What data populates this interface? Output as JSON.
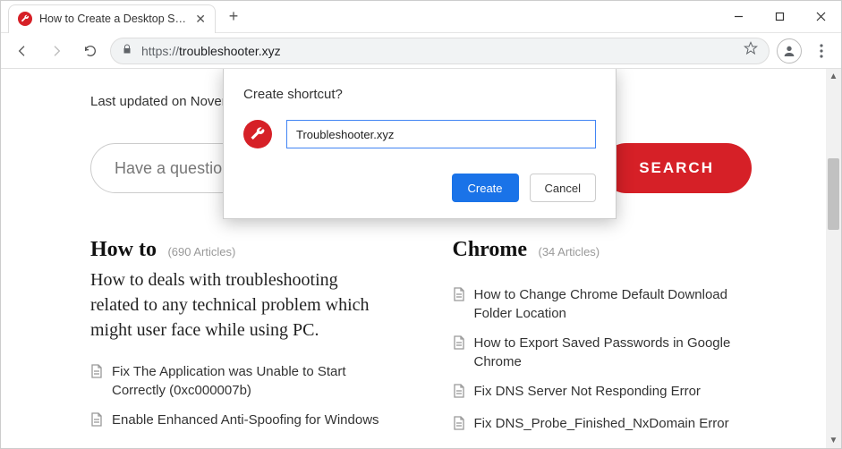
{
  "window": {
    "tab_title": "How to Create a Desktop Shortcu"
  },
  "toolbar": {
    "url_scheme": "https://",
    "url_rest": "troubleshooter.xyz"
  },
  "dialog": {
    "title": "Create shortcut?",
    "input_value": "Troubleshooter.xyz",
    "create_label": "Create",
    "cancel_label": "Cancel"
  },
  "page": {
    "last_updated": "Last updated on November",
    "search_placeholder": "Have a question?",
    "search_button": "SEARCH",
    "columns": [
      {
        "heading": "How to",
        "count": "(690 Articles)",
        "description": "How to deals with troubleshooting related to any technical problem which might user face while using PC.",
        "articles": [
          "Fix The Application was Unable to Start Correctly (0xc000007b)",
          "Enable Enhanced Anti-Spoofing for Windows"
        ]
      },
      {
        "heading": "Chrome",
        "count": "(34 Articles)",
        "description": "",
        "articles": [
          "How to Change Chrome Default Download Folder Location",
          "How to Export Saved Passwords in Google Chrome",
          "Fix DNS Server Not Responding Error",
          "Fix DNS_Probe_Finished_NxDomain Error"
        ]
      }
    ]
  }
}
